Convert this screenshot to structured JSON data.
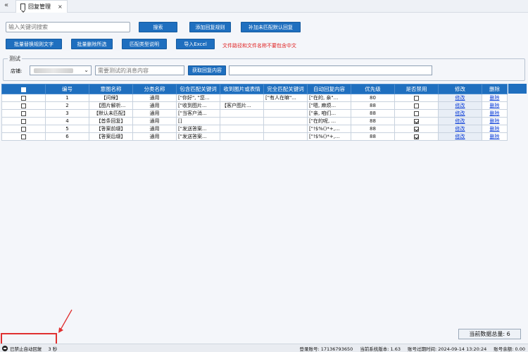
{
  "tab": {
    "title": "回复管理",
    "close": "×"
  },
  "toolbar": {
    "search_placeholder": "输入关键词搜索",
    "search": "搜索",
    "add_rule": "添加回复规则",
    "add_default": "补加未匹配默认回复",
    "batch_replace": "批量替换规则文字",
    "batch_delete": "批量删除所选",
    "match_type": "匹配类型说明",
    "import_excel": "导入Excel",
    "warning": "文件路径和文件名称不要包含中文"
  },
  "test_panel": {
    "label": "测试",
    "store_label": "店铺:",
    "message_placeholder": "需要测试的消息内容",
    "fetch_button": "获取回复内容"
  },
  "table": {
    "headers": [
      "编号",
      "意图名称",
      "分类名称",
      "包含匹配关键词",
      "收到图片或表情",
      "完全匹配关键词",
      "自动回复内容",
      "优先级",
      "是否禁用",
      "修改",
      "删除"
    ],
    "rows": [
      {
        "id": "1",
        "intent": "【问候】",
        "category": "通用",
        "contains": "[\"你好\", \"您...",
        "image": "",
        "exact": "[\"有人在嘛\"...",
        "reply": "[\"在的, 亲\"...",
        "priority": "80",
        "disabled": false,
        "edit": "修改",
        "delete": "删除"
      },
      {
        "id": "2",
        "intent": "【图片解析...",
        "category": "通用",
        "contains": "[\"收到图片...",
        "image": "【客户图片...",
        "exact": "",
        "reply": "[\"嗯, 麻烦...",
        "priority": "88",
        "disabled": false,
        "edit": "修改",
        "delete": "删除"
      },
      {
        "id": "3",
        "intent": "【默认未匹配】",
        "category": "通用",
        "contains": "[\"当客户消...",
        "image": "",
        "exact": "",
        "reply": "[\"亲, 咱们...",
        "priority": "88",
        "disabled": false,
        "edit": "修改",
        "delete": "删除"
      },
      {
        "id": "4",
        "intent": "【首条回复】",
        "category": "通用",
        "contains": "[]",
        "image": "",
        "exact": "",
        "reply": "[\"在的呢, ...",
        "priority": "88",
        "disabled": true,
        "edit": "修改",
        "delete": "删除"
      },
      {
        "id": "5",
        "intent": "【答案前缀】",
        "category": "通用",
        "contains": "[\"发送答案...",
        "image": "",
        "exact": "",
        "reply": "[\"!$%()*+,...",
        "priority": "88",
        "disabled": true,
        "edit": "修改",
        "delete": "删除"
      },
      {
        "id": "6",
        "intent": "【答案后缀】",
        "category": "通用",
        "contains": "[\"发送答案...",
        "image": "",
        "exact": "",
        "reply": "[\"!$%()*+,...",
        "priority": "88",
        "disabled": true,
        "edit": "修改",
        "delete": "删除"
      }
    ]
  },
  "total": "当前数据总量: 6",
  "status": {
    "auto_reply": "已禁止自动回复",
    "seconds": "3 秒",
    "account": "登录账号: 17136793650",
    "version": "当前系统版本: 1.63",
    "expiry": "账号过期时间: 2024-09-14 13:20:24",
    "balance": "账号余额: 0.00"
  },
  "colors": {
    "primary": "#1f6fbf",
    "warning": "#e02020",
    "highlight": "#e03030"
  }
}
